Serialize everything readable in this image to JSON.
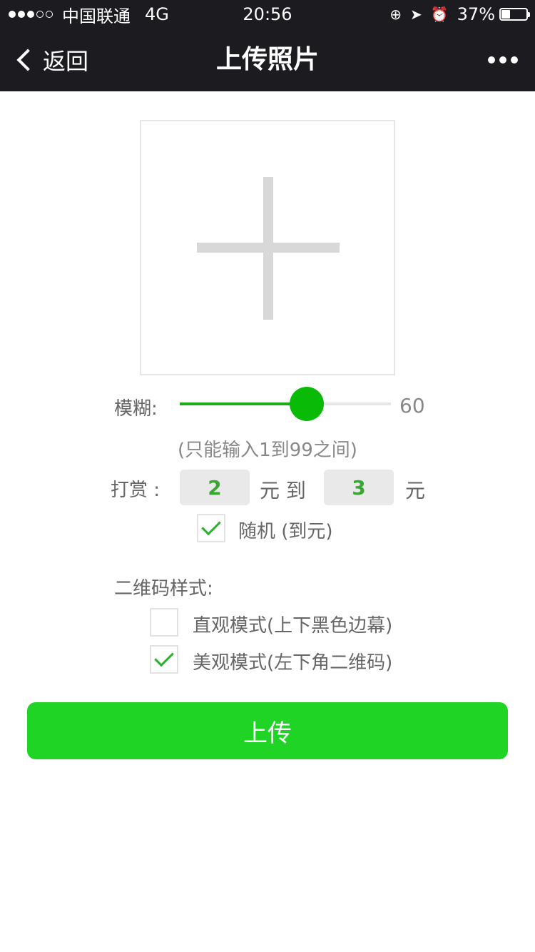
{
  "status_bar": {
    "carrier": "中国联通",
    "network": "4G",
    "time": "20:56",
    "battery_percent": "37%",
    "battery_level": 0.37
  },
  "nav": {
    "back_label": "返回",
    "title": "上传照片"
  },
  "blur": {
    "label": "模糊:",
    "value": 60,
    "value_text": "60",
    "min": 1,
    "max": 99,
    "hint": "(只能输入1到99之间)"
  },
  "reward": {
    "label": "打赏 :",
    "min_value": "2",
    "max_value": "3",
    "unit": "元",
    "to_text": "元 到",
    "random_label": "随机 (到元)",
    "random_checked": true
  },
  "qr_style": {
    "title": "二维码样式:",
    "options": [
      {
        "label": "直观模式(上下黑色边幕)",
        "checked": false
      },
      {
        "label": "美观模式(左下角二维码)",
        "checked": true
      }
    ]
  },
  "upload_button": {
    "label": "上传"
  },
  "colors": {
    "nav_bg": "#1c1b20",
    "accent": "#1aad19",
    "button": "#1fd424"
  },
  "icons": {
    "back": "chevron-left-icon",
    "more": "more-dots-icon",
    "add": "plus-icon",
    "check": "check-icon"
  }
}
